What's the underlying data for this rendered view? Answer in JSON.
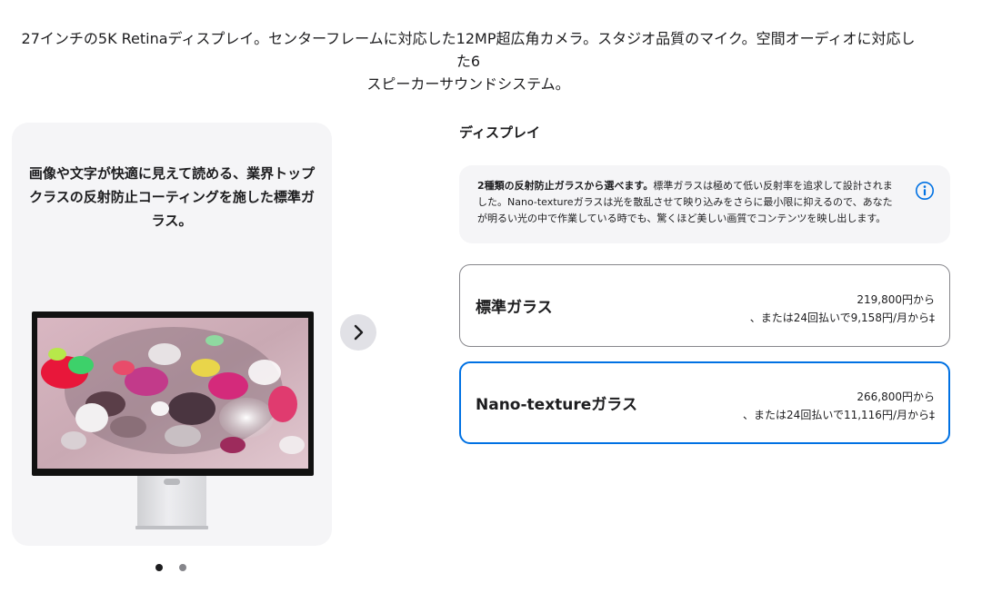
{
  "intro": {
    "line1": "27インチの5K Retinaディスプレイ。センターフレームに対応した12MP超広角カメラ。スタジオ品質のマイク。空間オーディオに対応した6",
    "line2": "スピーカーサウンドシステム。"
  },
  "gallery": {
    "caption_line1": "画像や文字が快適に見えて読める、業界トップ",
    "caption_line2": "クラスの反射防止コーティングを施した標準ガ",
    "caption_line3": "ラス。",
    "next_icon": "chevron-right-icon",
    "page_count": 2,
    "active_page": 1
  },
  "display_section": {
    "title": "ディスプレイ",
    "info": {
      "bold": "2種類の反射防止ガラスから選べます。",
      "text": "標準ガラスは極めて低い反射率を追求して設計されました。Nano-textureガラスは光を散乱させて映り込みをさらに最小限に抑えるので、あなたが明るい光の中で作業している時でも、驚くほど美しい画質でコンテンツを映し出します。",
      "icon": "info-icon"
    },
    "options": [
      {
        "name": "標準ガラス",
        "price": "219,800円から",
        "installment": "、または24回払いで9,158円/月から‡",
        "selected": false
      },
      {
        "name": "Nano-textureガラス",
        "price": "266,800円から",
        "installment": "、または24回払いで11,116円/月から‡",
        "selected": true
      }
    ]
  },
  "colors": {
    "accent": "#0071e3",
    "card_bg": "#f5f5f7",
    "text": "#1d1d1f"
  }
}
